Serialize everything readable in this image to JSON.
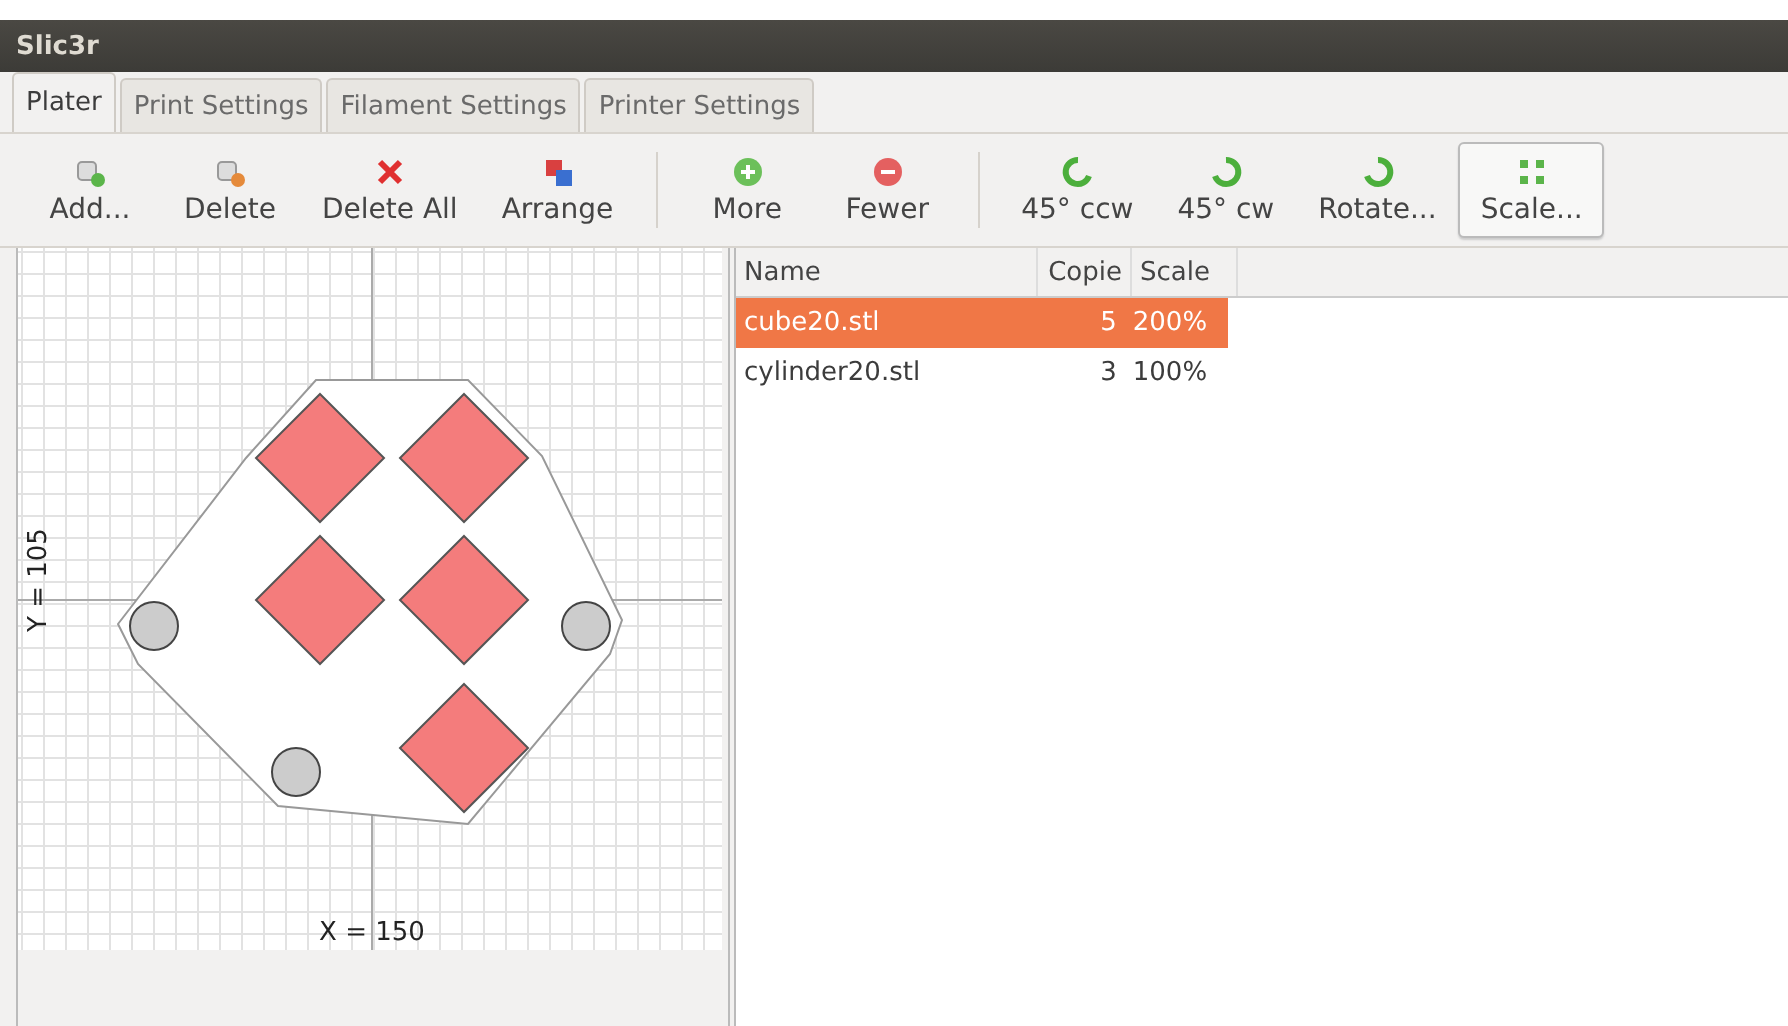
{
  "window": {
    "title": "Slic3r"
  },
  "tabs": [
    {
      "label": "Plater",
      "selected": true
    },
    {
      "label": "Print Settings",
      "selected": false
    },
    {
      "label": "Filament Settings",
      "selected": false
    },
    {
      "label": "Printer Settings",
      "selected": false
    }
  ],
  "toolbar": [
    [
      {
        "label": "Add...",
        "kind": "add",
        "hovered": false
      },
      {
        "label": "Delete",
        "kind": "delete",
        "hovered": false
      },
      {
        "label": "Delete All",
        "kind": "delete_all",
        "hovered": false
      },
      {
        "label": "Arrange",
        "kind": "arrange",
        "hovered": false
      }
    ],
    [
      {
        "label": "More",
        "kind": "more",
        "hovered": false
      },
      {
        "label": "Fewer",
        "kind": "fewer",
        "hovered": false
      }
    ],
    [
      {
        "label": "45° ccw",
        "kind": "ccw",
        "hovered": false
      },
      {
        "label": "45° cw",
        "kind": "cw",
        "hovered": false
      },
      {
        "label": "Rotate...",
        "kind": "rotate",
        "hovered": false
      },
      {
        "label": "Scale...",
        "kind": "scale",
        "hovered": true
      }
    ]
  ],
  "plater": {
    "x_label": "X = 150",
    "y_label": "Y = 105"
  },
  "table": {
    "columns": [
      "Name",
      "Copie",
      "Scale"
    ],
    "rows": [
      {
        "name": "cube20.stl",
        "copies": "5",
        "scale": "200%",
        "selected": true
      },
      {
        "name": "cylinder20.stl",
        "copies": "3",
        "scale": "100%",
        "selected": false
      }
    ]
  }
}
